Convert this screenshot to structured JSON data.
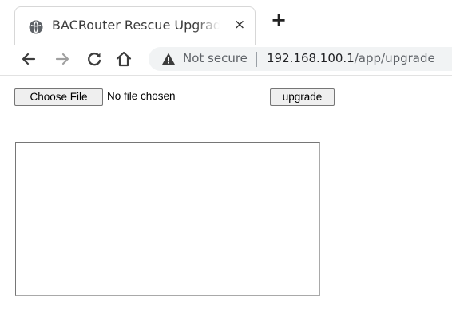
{
  "browser": {
    "tab": {
      "title": "BACRouter Rescue Upgrade",
      "close_glyph": "×",
      "favicon": "globe-icon"
    },
    "new_tab_glyph": "+",
    "toolbar": {
      "back_icon": "back-arrow-icon",
      "forward_icon": "forward-arrow-icon",
      "reload_icon": "reload-icon",
      "home_icon": "home-icon"
    },
    "omnibox": {
      "security_icon": "warning-icon",
      "security_label": "Not secure",
      "url_host": "192.168.100.1",
      "url_path": "/app/upgrade"
    }
  },
  "page": {
    "file_input": {
      "button_label": "Choose File",
      "status": "No file chosen"
    },
    "upgrade_button_label": "upgrade",
    "output_textarea": {
      "value": ""
    }
  }
}
